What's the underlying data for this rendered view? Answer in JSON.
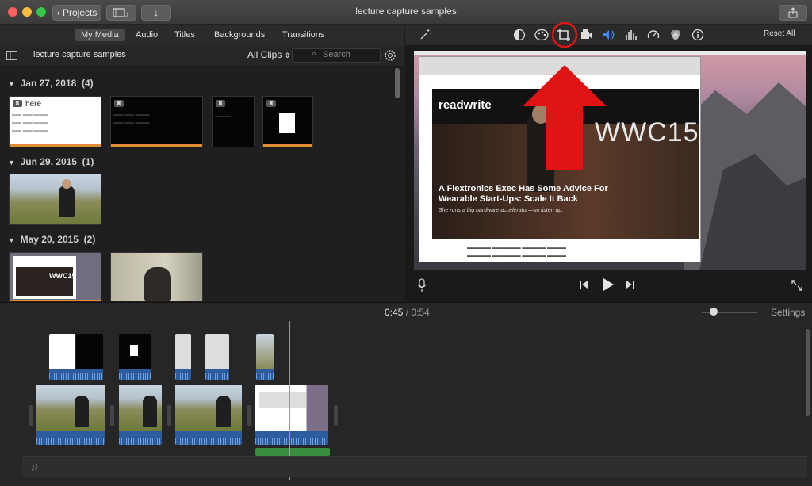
{
  "window": {
    "title": "lecture capture samples"
  },
  "toolbar": {
    "projects_label": "Projects"
  },
  "library": {
    "tabs": [
      {
        "label": "My Media",
        "selected": true
      },
      {
        "label": "Audio",
        "selected": false
      },
      {
        "label": "Titles",
        "selected": false
      },
      {
        "label": "Backgrounds",
        "selected": false
      },
      {
        "label": "Transitions",
        "selected": false
      }
    ],
    "event_name": "lecture capture samples",
    "filter": "All Clips",
    "search_placeholder": "Search",
    "groups": [
      {
        "date": "Jan 27, 2018",
        "count": "(4)"
      },
      {
        "date": "Jun 29, 2015",
        "count": "(1)"
      },
      {
        "date": "May 20, 2015",
        "count": "(2)"
      }
    ],
    "clip1_text": "here"
  },
  "viewer": {
    "reset_label": "Reset All",
    "article": {
      "brand": "readwrite",
      "headline": "A Flextronics Exec Has Some Advice For Wearable Start-Ups: Scale It Back",
      "subhead": "She runs a big hardware accelerator—so listen up.",
      "banner": "WWC15"
    }
  },
  "timeline": {
    "current_time": "0:45",
    "separator": "/",
    "total_time": "0:54",
    "settings_label": "Settings"
  },
  "colors": {
    "accent": "#e08b36",
    "annotation": "#e01414",
    "audio_blue": "#2c5c9c"
  }
}
